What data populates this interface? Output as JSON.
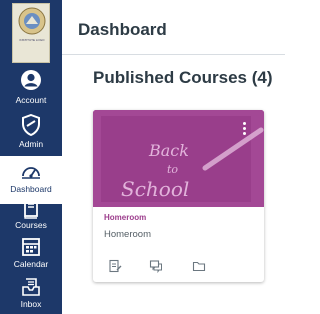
{
  "colors": {
    "nav_bg": "#1d3869",
    "card_accent": "#9c3c8c",
    "text_dark": "#2d3b45"
  },
  "nav": {
    "logo_text": "INSTITUTE LOGO",
    "items": [
      {
        "label": "Account",
        "icon": "account-icon"
      },
      {
        "label": "Admin",
        "icon": "admin-icon"
      },
      {
        "label": "Dashboard",
        "icon": "dashboard-icon"
      },
      {
        "label": "Courses",
        "icon": "courses-icon"
      },
      {
        "label": "Calendar",
        "icon": "calendar-icon"
      },
      {
        "label": "Inbox",
        "icon": "inbox-icon"
      }
    ]
  },
  "header": {
    "title": "Dashboard"
  },
  "main": {
    "section_title": "Published Courses (4)",
    "courses": [
      {
        "name": "Homeroom",
        "code": "Homeroom",
        "image_text": [
          "Back",
          "to",
          "School"
        ],
        "actions": [
          "assignments-icon",
          "discussions-icon",
          "files-icon"
        ]
      }
    ]
  }
}
